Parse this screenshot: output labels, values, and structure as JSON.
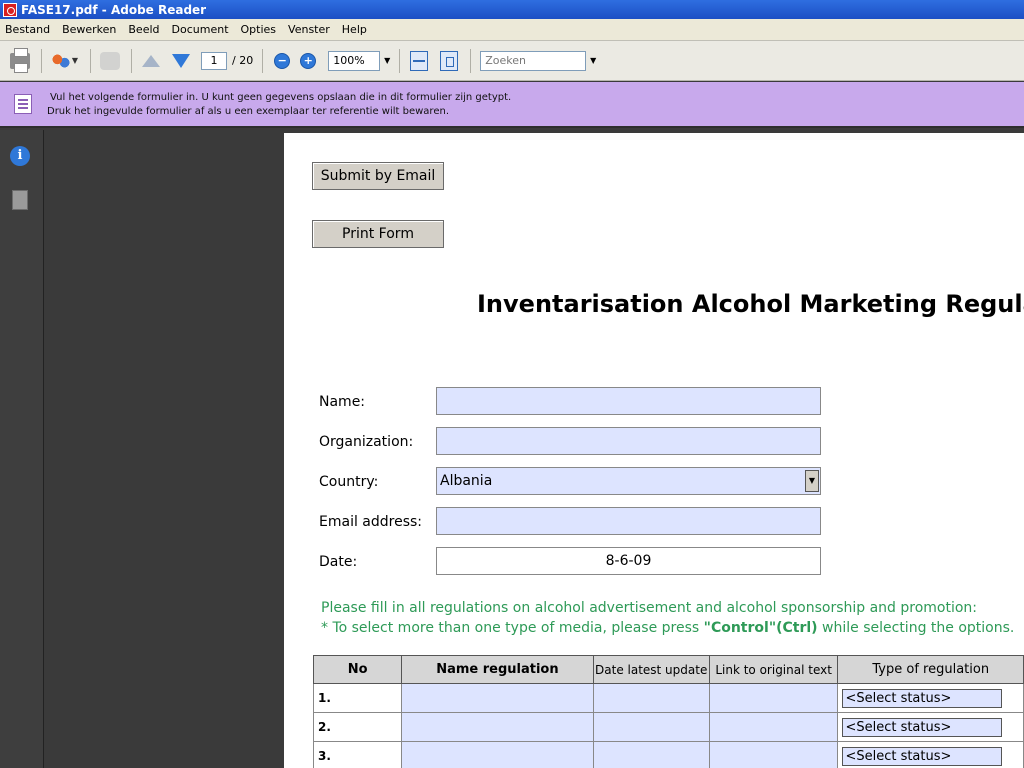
{
  "window": {
    "title": "FASE17.pdf - Adobe Reader"
  },
  "menu": [
    "Bestand",
    "Bewerken",
    "Beeld",
    "Document",
    "Opties",
    "Venster",
    "Help"
  ],
  "toolbar": {
    "page_current": "1",
    "page_total": "/ 20",
    "zoom": "100%",
    "search_placeholder": "Zoeken"
  },
  "message_bar": {
    "line1": "Vul het volgende formulier in. U kunt geen gegevens opslaan die in dit formulier zijn getypt.",
    "line2": "Druk het ingevulde formulier af als u een exemplaar ter referentie wilt bewaren."
  },
  "form": {
    "submit_button": "Submit by Email",
    "print_button": "Print Form",
    "title": "Inventarisation Alcohol Marketing Regulat",
    "fields": {
      "name_label": "Name:",
      "name_value": "",
      "organization_label": "Organization:",
      "organization_value": "",
      "country_label": "Country:",
      "country_value": "Albania",
      "email_label": "Email address:",
      "email_value": "",
      "date_label": "Date:",
      "date_value": "8-6-09"
    },
    "instruction1": "Please fill in all regulations on alcohol advertisement and alcohol sponsorship and promotion:",
    "instruction2_pre": "* To select more than one type of media, please press ",
    "instruction2_bold": "\"Control\"(Ctrl)",
    "instruction2_post": " while selecting the options.",
    "table": {
      "headers": [
        "No",
        "Name regulation",
        "Date latest update",
        "Link to original text",
        "Type of regulation"
      ],
      "rows": [
        {
          "no": "1.",
          "status": "<Select status>"
        },
        {
          "no": "2.",
          "status": "<Select status>"
        },
        {
          "no": "3.",
          "status": "<Select status>"
        }
      ]
    }
  }
}
